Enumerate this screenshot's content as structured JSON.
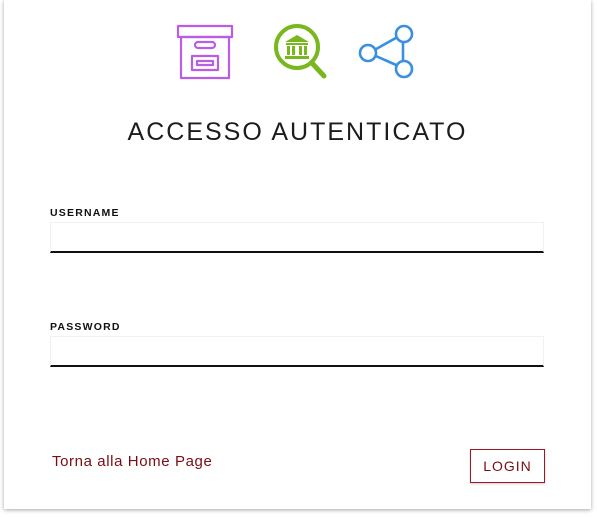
{
  "icons": {
    "archive": {
      "name": "archive-box-icon",
      "color": "#b95ce6"
    },
    "search": {
      "name": "museum-search-icon",
      "color": "#78b81e"
    },
    "share": {
      "name": "share-network-icon",
      "color": "#3a8fe0"
    }
  },
  "header": {
    "title": "ACCESSO AUTENTICATO"
  },
  "form": {
    "username_label": "USERNAME",
    "username_value": "",
    "password_label": "PASSWORD",
    "password_value": ""
  },
  "footer": {
    "home_link": "Torna alla Home Page",
    "login_label": "LOGIN"
  },
  "colors": {
    "accent": "#7a0c14",
    "underline": "#111111"
  }
}
